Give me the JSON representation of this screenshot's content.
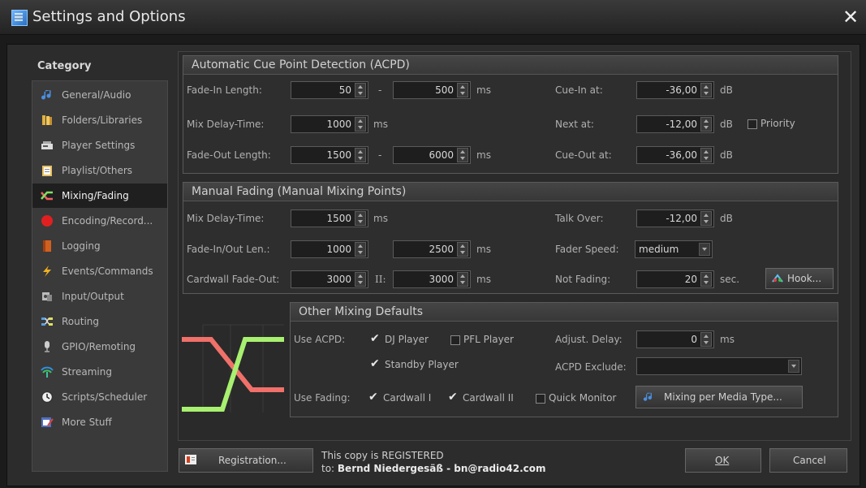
{
  "window": {
    "title": "Settings and Options",
    "close": "✕"
  },
  "sidebar": {
    "title": "Category",
    "items": [
      {
        "label": "General/Audio"
      },
      {
        "label": "Folders/Libraries"
      },
      {
        "label": "Player Settings"
      },
      {
        "label": "Playlist/Others"
      },
      {
        "label": "Mixing/Fading"
      },
      {
        "label": "Encoding/Record..."
      },
      {
        "label": "Logging"
      },
      {
        "label": "Events/Commands"
      },
      {
        "label": "Input/Output"
      },
      {
        "label": "Routing"
      },
      {
        "label": "GPIO/Remoting"
      },
      {
        "label": "Streaming"
      },
      {
        "label": "Scripts/Scheduler"
      },
      {
        "label": "More Stuff"
      }
    ]
  },
  "acpd": {
    "title": "Automatic Cue Point Detection (ACPD)",
    "fadein_label": "Fade-In Length:",
    "fadein_from": "50",
    "fadein_to": "500",
    "dash": "-",
    "ms": "ms",
    "mixdelay_label": "Mix Delay-Time:",
    "mixdelay": "1000",
    "fadeout_label": "Fade-Out Length:",
    "fadeout_from": "1500",
    "fadeout_to": "6000",
    "cuein_label": "Cue-In at:",
    "cuein": "-36,00",
    "next_label": "Next at:",
    "next": "-12,00",
    "cueout_label": "Cue-Out at:",
    "cueout": "-36,00",
    "db": "dB",
    "priority_label": "Priority"
  },
  "manual": {
    "title": "Manual Fading (Manual Mixing Points)",
    "mixdelay_label": "Mix Delay-Time:",
    "mixdelay": "1500",
    "fadeinout_label": "Fade-In/Out Len.:",
    "fadein": "1000",
    "fadeout": "2500",
    "cardwall_label": "Cardwall Fade-Out:",
    "cardwall1": "3000",
    "cardwall_ii": "II:",
    "cardwall2": "3000",
    "ms": "ms",
    "talkover_label": "Talk Over:",
    "talkover": "-12,00",
    "db": "dB",
    "faderspeed_label": "Fader Speed:",
    "faderspeed": "medium",
    "notfading_label": "Not Fading:",
    "notfading": "20",
    "sec": "sec.",
    "hook_label": "Hook..."
  },
  "other": {
    "title": "Other Mixing Defaults",
    "use_acpd_label": "Use ACPD:",
    "dj_player": "DJ Player",
    "pfl_player": "PFL Player",
    "standby_player": "Standby Player",
    "adjust_delay_label": "Adjust. Delay:",
    "adjust_delay": "0",
    "ms": "ms",
    "acpd_exclude_label": "ACPD Exclude:",
    "acpd_exclude": "",
    "use_fading_label": "Use Fading:",
    "cardwall_i": "Cardwall I",
    "cardwall_ii": "Cardwall II",
    "quick_monitor": "Quick Monitor",
    "mixing_per_media": "Mixing per Media Type..."
  },
  "footer": {
    "registration": "Registration...",
    "reg_line1": "This copy is REGISTERED",
    "reg_line2_prefix": "to: ",
    "reg_line2_name": "Bernd Niedergesäß - bn@radio42.com",
    "ok": "OK",
    "cancel": "Cancel"
  },
  "colors": {
    "fade_out_line": "#f0706a",
    "fade_in_line": "#a8f070",
    "selected_bg": "#1f1f1f"
  }
}
